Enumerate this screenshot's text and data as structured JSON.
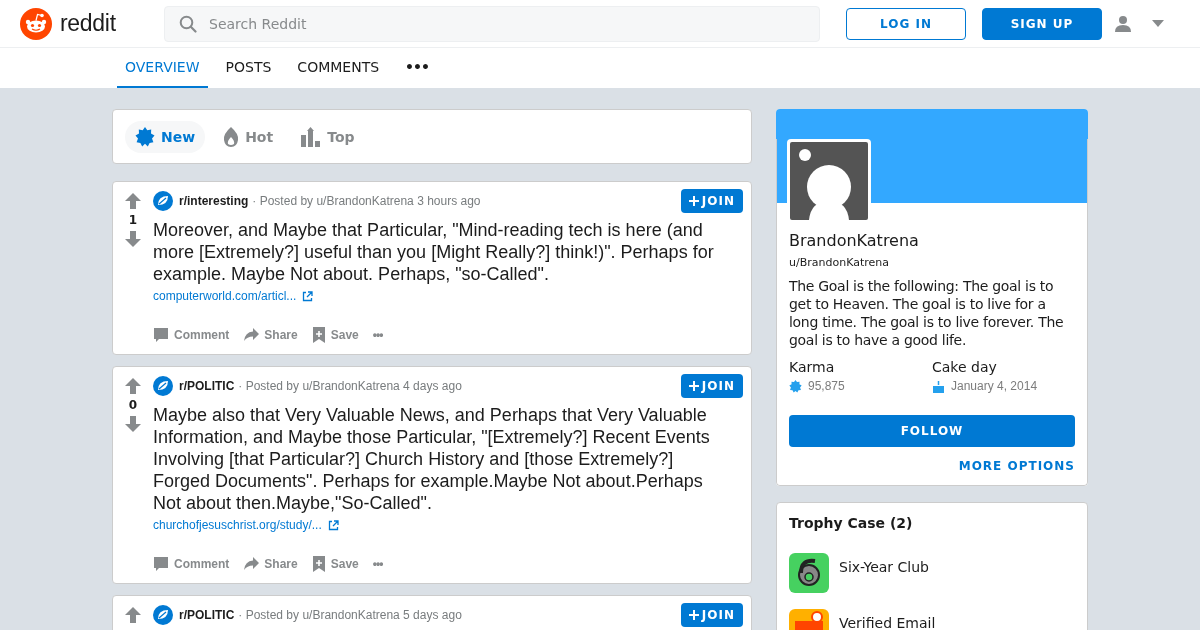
{
  "header": {
    "logo_text": "reddit",
    "search": {
      "placeholder": "Search Reddit"
    },
    "login": "LOG IN",
    "signup": "SIGN UP"
  },
  "nav": {
    "tabs": [
      {
        "label": "OVERVIEW",
        "selected": true
      },
      {
        "label": "POSTS",
        "selected": false
      },
      {
        "label": "COMMENTS",
        "selected": false
      }
    ],
    "more": "•••"
  },
  "sort": [
    {
      "label": "New",
      "kind": "new",
      "selected": true
    },
    {
      "label": "Hot",
      "kind": "hot",
      "selected": false
    },
    {
      "label": "Top",
      "kind": "top",
      "selected": false
    }
  ],
  "posts": [
    {
      "votes": "1",
      "subreddit": "r/interesting",
      "meta": "· Posted by u/BrandonKatrena 3 hours ago",
      "join": "JOIN",
      "title": "Moreover, and Maybe that Particular, \"Mind-reading tech is here (and more [Extremely?] useful than you [Might Really?] think!)\". Perhaps for example. Maybe Not about. Perhaps, \"so-Called\".",
      "link": "computerworld.com/articl...",
      "actions": [
        {
          "label": "Comment",
          "kind": "comment"
        },
        {
          "label": "Share",
          "kind": "share"
        },
        {
          "label": "Save",
          "kind": "save"
        }
      ],
      "more": "•••"
    },
    {
      "votes": "0",
      "subreddit": "r/POLITIC",
      "meta": "· Posted by u/BrandonKatrena 4 days ago",
      "join": "JOIN",
      "title": "Maybe also that Very Valuable News, and Perhaps that Very Valuable Information, and Maybe those Particular, \"[Extremely?] Recent Events Involving [that Particular?] Church History and [those Extremely?] Forged Documents\". Perhaps for example.Maybe Not about.Perhaps Not about then.Maybe,\"So-Called\".",
      "link": "churchofjesuschrist.org/study/...",
      "actions": [
        {
          "label": "Comment",
          "kind": "comment"
        },
        {
          "label": "Share",
          "kind": "share"
        },
        {
          "label": "Save",
          "kind": "save"
        }
      ],
      "more": "•••"
    },
    {
      "subreddit": "r/POLITIC",
      "meta": "· Posted by u/BrandonKatrena 5 days ago",
      "join": "JOIN"
    }
  ],
  "profile": {
    "name": "BrandonKatrena",
    "handle": "u/BrandonKatrena",
    "bio": "The Goal is the following: The goal is to get to Heaven. The goal is to live for a long time. The goal is to live forever. The goal is to have a good life.",
    "karma_label": "Karma",
    "karma": "95,875",
    "cakeday_label": "Cake day",
    "cakeday": "January 4, 2014",
    "follow": "FOLLOW",
    "more_options": "MORE OPTIONS"
  },
  "trophies": {
    "title": "Trophy Case (2)",
    "items": [
      {
        "name": "Six-Year Club",
        "kind": "six-year"
      },
      {
        "name": "Verified Email",
        "kind": "verified-email"
      }
    ]
  }
}
